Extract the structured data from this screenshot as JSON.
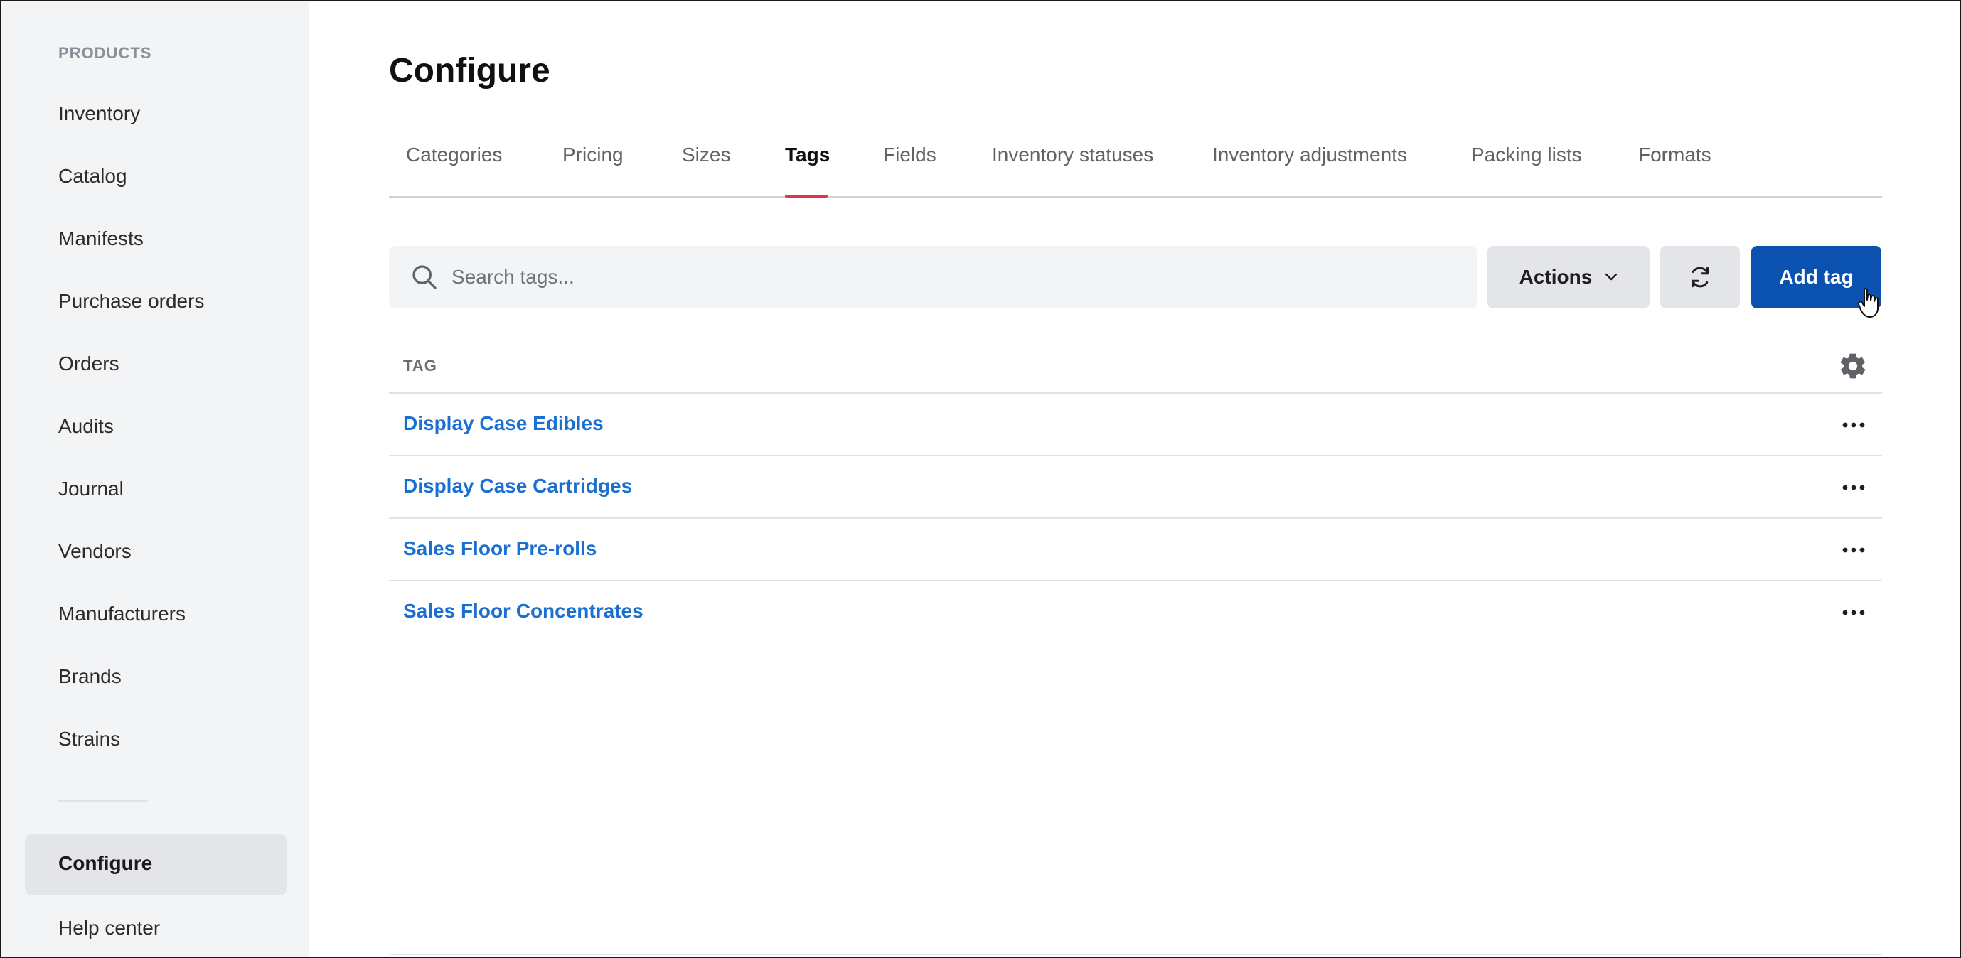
{
  "sidebar": {
    "section_title": "PRODUCTS",
    "items": [
      {
        "label": "Inventory"
      },
      {
        "label": "Catalog"
      },
      {
        "label": "Manifests"
      },
      {
        "label": "Purchase orders"
      },
      {
        "label": "Orders"
      },
      {
        "label": "Audits"
      },
      {
        "label": "Journal"
      },
      {
        "label": "Vendors"
      },
      {
        "label": "Manufacturers"
      },
      {
        "label": "Brands"
      },
      {
        "label": "Strains"
      }
    ],
    "active_item": "Configure",
    "help": "Help center"
  },
  "page": {
    "title": "Configure"
  },
  "tabs": [
    {
      "label": "Categories"
    },
    {
      "label": "Pricing"
    },
    {
      "label": "Sizes"
    },
    {
      "label": "Tags"
    },
    {
      "label": "Fields"
    },
    {
      "label": "Inventory statuses"
    },
    {
      "label": "Inventory adjustments"
    },
    {
      "label": "Packing lists"
    },
    {
      "label": "Formats"
    }
  ],
  "active_tab": "Tags",
  "toolbar": {
    "search_placeholder": "Search tags...",
    "actions_label": "Actions",
    "add_label": "Add tag"
  },
  "table": {
    "column_header": "TAG",
    "rows": [
      {
        "name": "Display Case Edibles"
      },
      {
        "name": "Display Case Cartridges"
      },
      {
        "name": "Sales Floor Pre-rolls"
      },
      {
        "name": "Sales Floor Concentrates"
      }
    ]
  },
  "icons": {
    "search": "search-icon",
    "chevron": "chevron-down-icon",
    "refresh": "refresh-icon",
    "settings": "gear-icon",
    "more": "more-horizontal-icon",
    "cursor": "hand-pointer-icon"
  },
  "colors": {
    "primary": "#0b52b0",
    "link": "#1a6fd1",
    "tab_accent": "#e0334c",
    "sidebar_bg": "#f3f4f6"
  }
}
